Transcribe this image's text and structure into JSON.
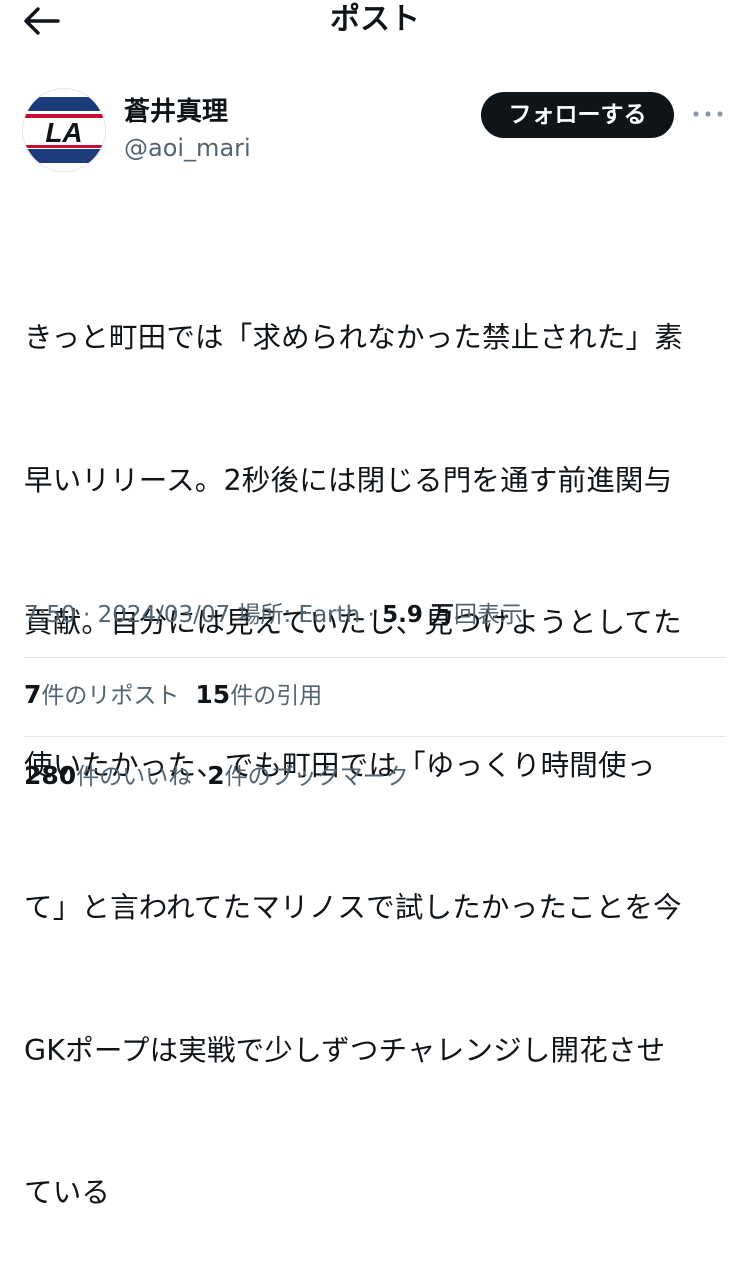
{
  "header": {
    "title": "ポスト",
    "back_icon": "arrow-left-icon"
  },
  "author": {
    "name": "蒼井真理",
    "handle": "@aoi_mari",
    "avatar_text": "LA",
    "follow_label": "フォローする",
    "more_icon": "more-horizontal-icon"
  },
  "post": {
    "lines": [
      "きっと町田では「求められなかった禁止された」素",
      "早いリリース。2秒後には閉じる門を通す前進関与",
      "貢献。自分には見えていたし、見つけようとしてた",
      "使いたかった、でも町田では「ゆっくり時間使っ",
      "て」と言われてたマリノスで試したかったことを今",
      "GKポープは実戦で少しずつチャレンジし開花させ",
      "ている"
    ]
  },
  "meta": {
    "time": "7:50",
    "sep1": " · ",
    "date": "2024/03/07",
    "location": "場所: Earth",
    "sep2": " · ",
    "views_value": "5.9 万",
    "views_label": "回表示"
  },
  "stats": {
    "reposts_value": "7",
    "reposts_label": "件のリポスト",
    "quotes_value": "15",
    "quotes_label": "件の引用",
    "likes_value": "280",
    "likes_label": "件のいいね",
    "bookmarks_value": "2",
    "bookmarks_label": "件のブックマーク"
  },
  "colors": {
    "text": "#0f1419",
    "muted": "#536471",
    "divider": "#e1e6ea",
    "button_bg": "#0f1419"
  }
}
